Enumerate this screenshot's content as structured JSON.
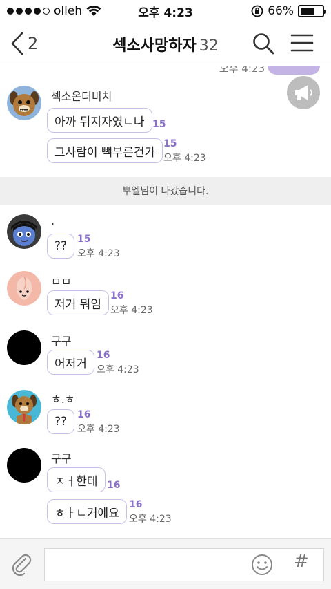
{
  "status_bar": {
    "carrier": "olleh",
    "time": "오후 4:23",
    "battery": "66%",
    "battery_level": 0.66,
    "signal_bars_filled": 4,
    "signal_bars_total": 5
  },
  "header": {
    "back_count": "2",
    "title": "섹소사망하자",
    "member_count": "32"
  },
  "chat": {
    "cut_time": "오후 4:23",
    "system_notice": "뿌엘님이 나갔습니다.",
    "messages": [
      {
        "sender": "섹소온더비치",
        "avatar": "brown-dog-character",
        "lines": [
          {
            "text": "아까 뒤지자였ㄴ나",
            "unread": "15",
            "time": ""
          },
          {
            "text": "그사람이 빽부른건가",
            "unread": "15",
            "time": "오후 4:23"
          }
        ]
      },
      {
        "sender": ".",
        "avatar": "blue-character-black-hair",
        "lines": [
          {
            "text": "??",
            "unread": "15",
            "time": "오후 4:23"
          }
        ]
      },
      {
        "sender": "ㅁㅁ",
        "avatar": "peach-character",
        "lines": [
          {
            "text": "저거 뭐임",
            "unread": "16",
            "time": "오후 4:23"
          }
        ]
      },
      {
        "sender": "구구",
        "avatar": "black-circle",
        "lines": [
          {
            "text": "어저거",
            "unread": "16",
            "time": "오후 4:23"
          }
        ]
      },
      {
        "sender": "ㅎ.ㅎ",
        "avatar": "dog-character-with-tie",
        "lines": [
          {
            "text": "??",
            "unread": "16",
            "time": "오후 4:23"
          }
        ]
      },
      {
        "sender": "구구",
        "avatar": "black-circle",
        "lines": [
          {
            "text": "ㅈㅓ한테",
            "unread": "16",
            "time": ""
          },
          {
            "text": "ㅎㅏㄴ거에요",
            "unread": "16",
            "time": "오후 4:23"
          }
        ]
      }
    ]
  },
  "input": {
    "placeholder": "",
    "hash_symbol": "#"
  },
  "colors": {
    "accent": "#8a70c8",
    "bubble_border": "#c9c0e8",
    "my_bubble": "#c4b4e6"
  }
}
